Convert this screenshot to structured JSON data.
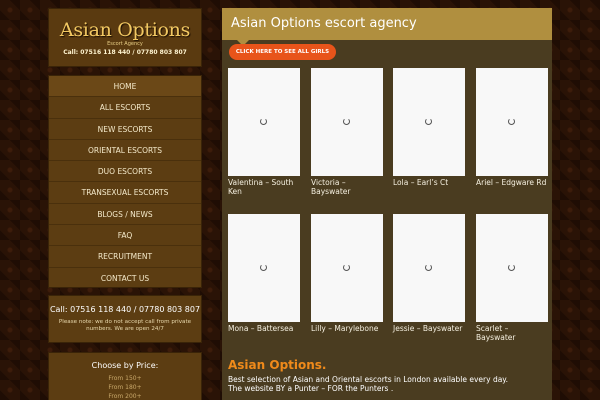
{
  "logo": {
    "title": "Asian Options",
    "subtitle": "Escort Agency",
    "phone": "Call: 07516 118 440 / 07780 803 807"
  },
  "nav": {
    "items": [
      {
        "label": "HOME"
      },
      {
        "label": "ALL ESCORTS"
      },
      {
        "label": "NEW ESCORTS"
      },
      {
        "label": "ORIENTAL ESCORTS"
      },
      {
        "label": "DUO ESCORTS"
      },
      {
        "label": "TRANSEXUAL ESCORTS"
      },
      {
        "label": "BLOGS / NEWS"
      },
      {
        "label": "FAQ"
      },
      {
        "label": "RECRUITMENT"
      },
      {
        "label": "CONTACT US"
      }
    ]
  },
  "contact": {
    "phone": "Call: 07516 118 440 / 07780 803 807",
    "note": "Please note: we do not accept call from private numbers. We are open 24/7"
  },
  "price": {
    "title": "Choose by Price:",
    "options": [
      "From 150+",
      "From 180+",
      "From 200+"
    ]
  },
  "main": {
    "title": "Asian Options escort agency",
    "see_all": "CLICK HERE TO SEE ALL GIRLS",
    "escorts": [
      {
        "name": "Valentina – South Ken"
      },
      {
        "name": "Victoria – Bayswater"
      },
      {
        "name": "Lola – Earl’s Ct"
      },
      {
        "name": "Ariel – Edgware Rd"
      },
      {
        "name": "Mona – Battersea"
      },
      {
        "name": "Lilly – Marylebone"
      },
      {
        "name": "Jessie – Bayswater"
      },
      {
        "name": "Scarlet – Bayswater"
      }
    ],
    "intro_title": "Asian Options.",
    "intro_line1": "Best selection of Asian and Oriental escorts in London available every day.",
    "intro_line2": "The website BY a Punter – FOR the Punters ."
  }
}
